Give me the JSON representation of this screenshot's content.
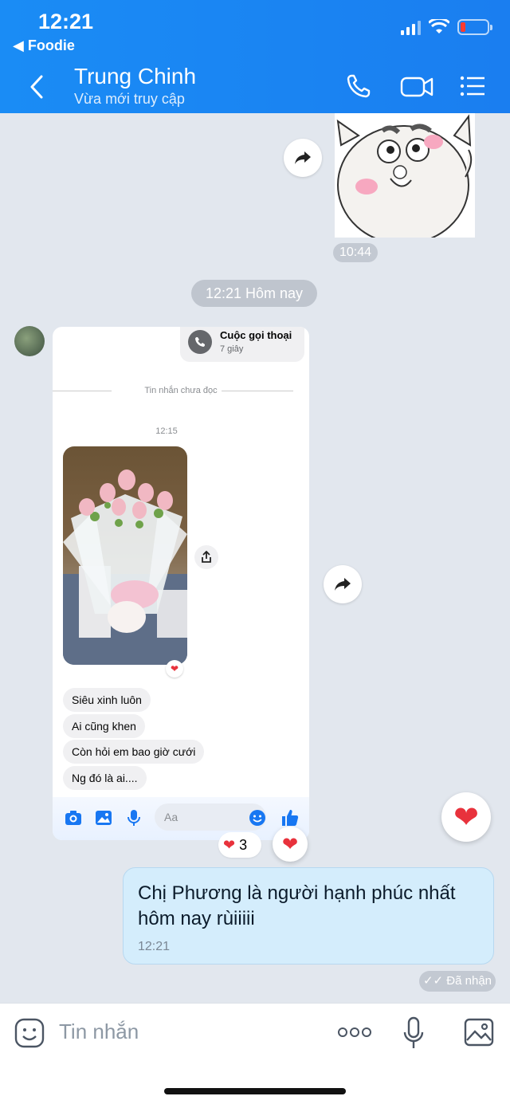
{
  "status_bar": {
    "time": "12:21",
    "back_app": "Foodie"
  },
  "header": {
    "name": "Trung Chinh",
    "status": "Vừa mới truy cập"
  },
  "messages": {
    "sticker_time": "10:44",
    "date_separator": "12:21 Hôm nay",
    "screenshot": {
      "call_title": "Cuộc gọi thoại",
      "call_duration": "7 giây",
      "unread_label": "Tin nhắn chưa đọc",
      "time": "12:15",
      "bubbles": [
        "Siêu xinh luôn",
        "Ai cũng khen",
        "Còn hỏi em bao giờ cưới",
        "Ng đó là ai...."
      ],
      "input_placeholder": "Aa"
    },
    "reaction_count": "3",
    "my_message": {
      "text": "Chị Phương là người hạnh phúc nhất hôm nay rùiiiii",
      "time": "12:21"
    },
    "delivered": "Đã nhận"
  },
  "composer": {
    "placeholder": "Tin nhắn"
  },
  "colors": {
    "header_blue": "#1a8cf5",
    "heart": "#e8323c",
    "my_bubble": "#d4edfc"
  }
}
